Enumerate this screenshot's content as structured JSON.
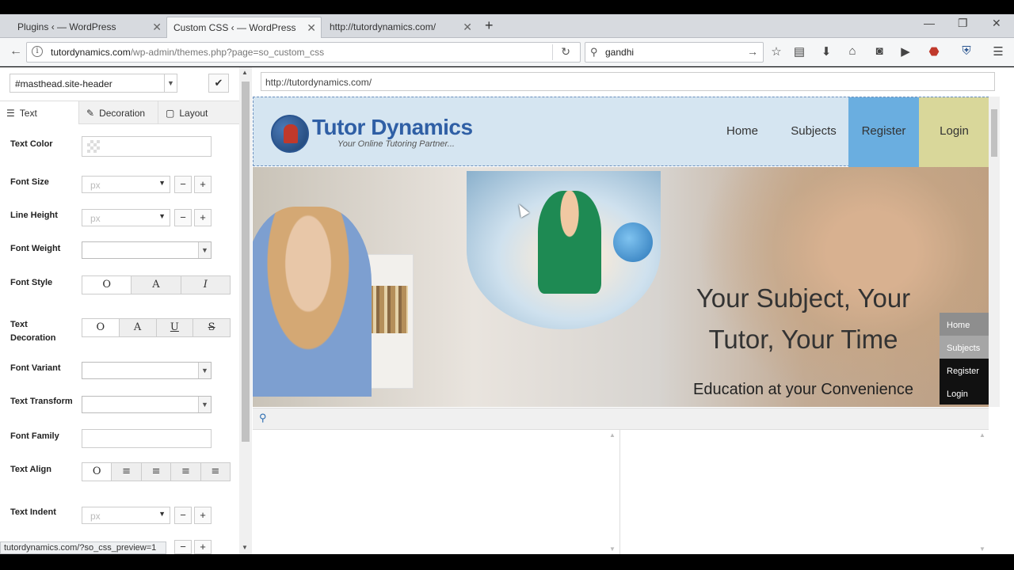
{
  "browser": {
    "tabs": [
      {
        "title": "Plugins ‹ — WordPress"
      },
      {
        "title": "Custom CSS ‹ — WordPress"
      },
      {
        "title": "http://tutordynamics.com/"
      }
    ],
    "url_domain": "tutordynamics.com",
    "url_path": "/wp-admin/themes.php?page=so_custom_css",
    "search_value": "gandhi",
    "status_text": "tutordynamics.com/?so_css_preview=1"
  },
  "panel": {
    "selector_value": "#masthead.site-header",
    "tabs": [
      {
        "label": "Text"
      },
      {
        "label": "Decoration"
      },
      {
        "label": "Layout"
      }
    ],
    "labels": {
      "text_color": "Text Color",
      "font_size": "Font Size",
      "line_height": "Line Height",
      "font_weight": "Font Weight",
      "font_style": "Font Style",
      "text_decoration": "Text Decoration",
      "font_variant": "Font Variant",
      "text_transform": "Text Transform",
      "font_family": "Font Family",
      "text_align": "Text Align",
      "text_indent": "Text Indent"
    },
    "unit_placeholder": "px",
    "font_style_options": [
      "O",
      "A",
      "I"
    ],
    "text_decoration_options": [
      "O",
      "A",
      "U",
      "S"
    ],
    "text_align_options": [
      "O",
      "≡",
      "≡",
      "≡",
      "≡"
    ]
  },
  "preview": {
    "url": "http://tutordynamics.com/",
    "site": {
      "logo_name": "Tutor Dynamics",
      "logo_tagline": "Your Online Tutoring Partner...",
      "nav": [
        "Home",
        "Subjects",
        "Register",
        "Login"
      ],
      "hero_heading": "Your Subject, Your Tutor, Your Time",
      "hero_subheading": "Education at your Convenience",
      "side_nav": [
        "Home",
        "Subjects",
        "Register",
        "Login"
      ]
    }
  },
  "colors": {
    "header_bg": "#d5e5f1",
    "register_bg": "#6aaee0",
    "login_bg": "#d9d79a",
    "logo_text": "#2f5fa5"
  }
}
